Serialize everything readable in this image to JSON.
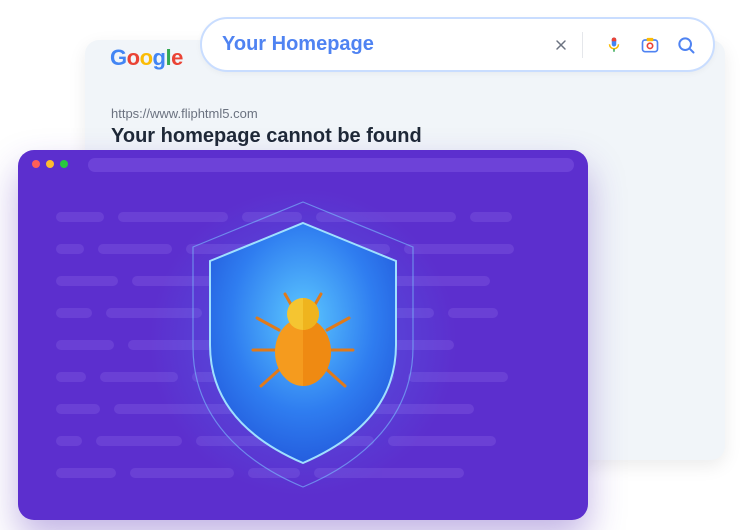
{
  "search": {
    "logo_letters": [
      "G",
      "o",
      "o",
      "g",
      "l",
      "e"
    ],
    "query": "Your Homepage"
  },
  "result": {
    "url": "https://www.fliphtml5.com",
    "title": "Your homepage cannot be found"
  }
}
